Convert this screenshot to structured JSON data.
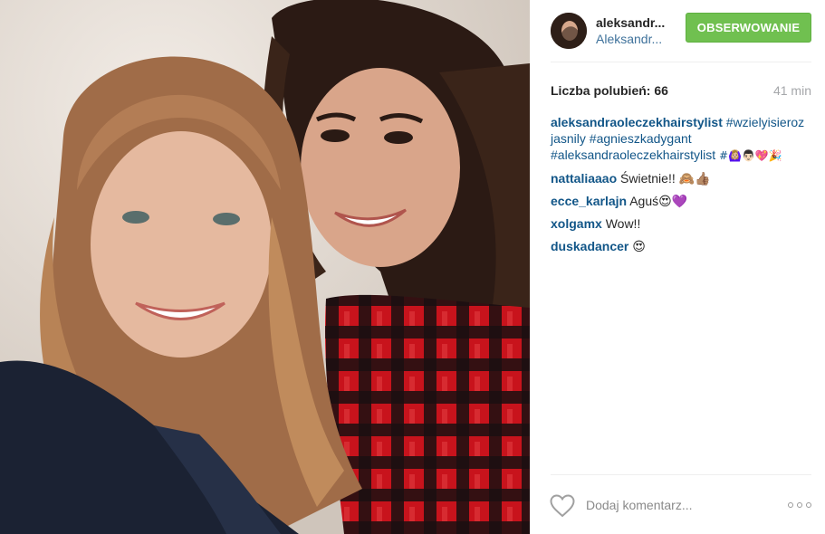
{
  "photo": {
    "alt_icon": "selfie-photo"
  },
  "header": {
    "username": "aleksandr...",
    "location": "Aleksandr...",
    "follow_label": "OBSERWOWANIE",
    "follow_color": "#70c050"
  },
  "stats": {
    "likes": "Liczba polubień: 66",
    "time": "41 min"
  },
  "caption": {
    "user": "aleksandraoleczekhairstylist",
    "text_tag1": "#wzielyisieroz jasnily",
    "text_tag2": "#agnieszkadygant",
    "text_tag3": "#aleksandraoleczekhairstylist",
    "emoji": "#🙆🏼‍♀️👨🏻💖🎉"
  },
  "comments": [
    {
      "user": "nattaliaaao",
      "text": "Świetnie!! 🙈👍🏽"
    },
    {
      "user": "ecce_karlajn",
      "text": "Aguś😍💜"
    },
    {
      "user": "xolgamx",
      "text": "Wow!!"
    },
    {
      "user": "duskadancer",
      "text": "😍"
    }
  ],
  "footer": {
    "comment_placeholder": "Dodaj komentarz...",
    "like_icon": "heart-outline-icon",
    "more_icon": "more-options-icon"
  },
  "colors": {
    "username": "#125688",
    "location": "#3f729b",
    "muted": "#a5a7aa"
  }
}
